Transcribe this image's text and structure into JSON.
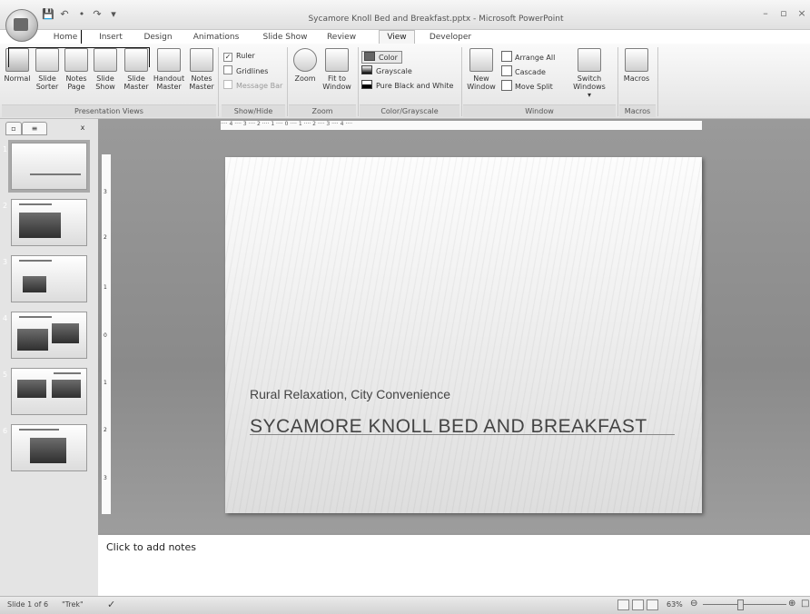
{
  "window": {
    "title": "Sycamore Knoll Bed and Breakfast.pptx - Microsoft PowerPoint"
  },
  "tabs": [
    "Home",
    "Insert",
    "Design",
    "Animations",
    "Slide Show",
    "Review",
    "View",
    "Developer"
  ],
  "active_tab": "View",
  "ribbon": {
    "presentation_views": {
      "label": "Presentation Views",
      "normal": "Normal",
      "slide_sorter": [
        "Slide",
        "Sorter"
      ],
      "notes_page": [
        "Notes",
        "Page"
      ],
      "slide_show": [
        "Slide",
        "Show"
      ],
      "slide_master": [
        "Slide",
        "Master"
      ],
      "handout_master": [
        "Handout",
        "Master"
      ],
      "notes_master": [
        "Notes",
        "Master"
      ]
    },
    "show_hide": {
      "label": "Show/Hide",
      "ruler": "Ruler",
      "gridlines": "Gridlines",
      "message_bar": "Message Bar"
    },
    "zoom": {
      "label": "Zoom",
      "zoom": "Zoom",
      "fit_to_window": [
        "Fit to",
        "Window"
      ]
    },
    "color_grayscale": {
      "label": "Color/Grayscale",
      "color": "Color",
      "grayscale": "Grayscale",
      "pure_bw": "Pure Black and White"
    },
    "window": {
      "label": "Window",
      "new_window": [
        "New",
        "Window"
      ],
      "arrange_all": "Arrange All",
      "cascade": "Cascade",
      "move_split": "Move Split",
      "switch_windows": [
        "Switch",
        "Windows ▾"
      ]
    },
    "macros": {
      "label": "Macros",
      "macros": "Macros"
    }
  },
  "slides_panel": {
    "close": "x",
    "numbers": [
      "1",
      "2",
      "3",
      "4",
      "5",
      "6"
    ]
  },
  "ruler": {
    "horizontal": "···· 4 ···· 3 ···· 2 ···· 1 ···· 0 ···· 1 ···· 2 ···· 3 ···· 4 ····",
    "vertical": [
      "3",
      "2",
      "1",
      "0",
      "1",
      "2",
      "3"
    ]
  },
  "slide": {
    "subtitle": "Rural Relaxation, City Convenience",
    "title": "SYCAMORE KNOLL BED AND BREAKFAST"
  },
  "notes": {
    "placeholder": "Click to add notes"
  },
  "status": {
    "slide_count": "Slide 1 of 6",
    "theme": "\"Trek\"",
    "zoom_percent": "63%"
  }
}
